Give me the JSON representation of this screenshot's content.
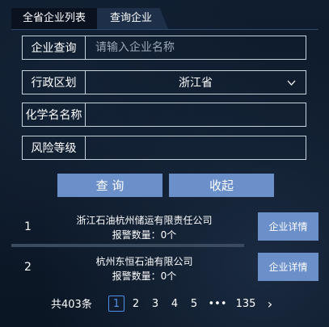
{
  "tabs": {
    "active": "全省企业列表",
    "inactive": "查询企业"
  },
  "form": {
    "company_label": "企业查询",
    "company_placeholder": "请输入企业名称",
    "region_label": "行政区划",
    "region_value": "浙江省",
    "chemical_label": "化学名名称",
    "chemical_value": "",
    "risk_label": "风险等级",
    "risk_value": ""
  },
  "buttons": {
    "query": "查 询",
    "collapse": "收起"
  },
  "results": [
    {
      "index": "1",
      "name": "浙江石油杭州储运有限责任公司",
      "count": "报警数量：0个",
      "detail": "企业详情"
    },
    {
      "index": "2",
      "name": "杭州东恒石油有限公司",
      "count": "报警数量：0个",
      "detail": "企业详情"
    }
  ],
  "pagination": {
    "total": "共403条",
    "pages": [
      "1",
      "2",
      "3",
      "4",
      "5"
    ],
    "current": "1",
    "ellipsis": "•••",
    "last": "135",
    "next": "›"
  },
  "colors": {
    "accent": "#6b8fc9",
    "current_page": "#4f8fe6",
    "background": "#0d1a2b"
  }
}
